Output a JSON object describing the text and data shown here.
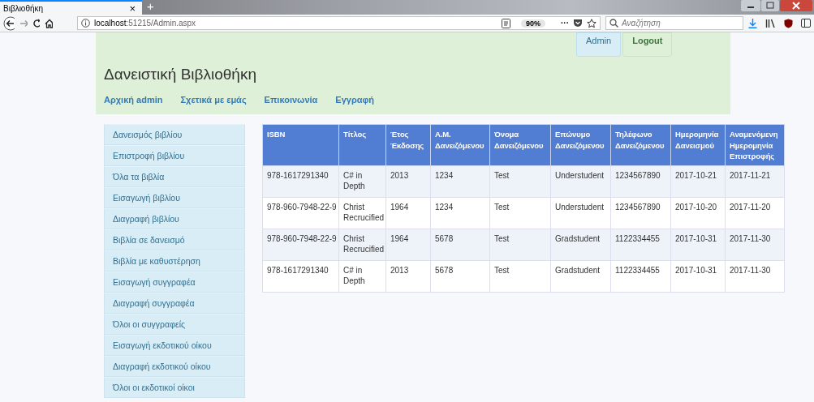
{
  "browser": {
    "tab": {
      "title": "Βιβλιοθήκη",
      "close": "×",
      "selected": true
    },
    "new_tab": "+",
    "url_host": "localhost",
    "url_path": ":51215/Admin.aspx",
    "zoom": "90%",
    "more": "···",
    "search": {
      "placeholder": "Αναζήτηση"
    }
  },
  "header": {
    "title": "Δανειστική Βιβλιοθήκη",
    "nav": [
      "Αρχική admin",
      "Σχετικά με εμάς",
      "Επικοινωνία",
      "Εγγραφή"
    ],
    "buttons": [
      {
        "label": "Admin",
        "kind": "info"
      },
      {
        "label": "Logout",
        "kind": "success"
      }
    ]
  },
  "sidebar": {
    "items": [
      "Δανεισμός βιβλίου",
      "Επιστροφή βιβλίου",
      "Όλα τα βιβλία",
      "Εισαγωγή βιβλίου",
      "Διαγραφή βιβλίου",
      "Βιβλία σε δανεισμό",
      "Βιβλία με καθυστέρηση",
      "Εισαγωγή συγγραφέα",
      "Διαγραφή συγγραφέα",
      "Όλοι οι συγγραφείς",
      "Εισαγωγή εκδοτικού οίκου",
      "Διαγραφή εκδοτικού οίκου",
      "Όλοι οι εκδοτικοί οίκοι"
    ]
  },
  "table": {
    "columns": [
      "ISBN",
      "Τίτλος",
      "Έτος Έκδοσης",
      "Α.Μ. Δανειζόμενου",
      "Όνομα Δανειζόμενου",
      "Επώνυμο Δανειζόμενου",
      "Τηλέφωνο Δανειζόμενου",
      "Ημερομηνία Δανεισμού",
      "Αναμενόμενη Ημερομηνία Επιστροφής"
    ],
    "rows": [
      [
        "978-1617291340",
        "C# in Depth",
        "2013",
        "1234",
        "Test",
        "Understudent",
        "1234567890",
        "2017-10-21",
        "2017-11-21"
      ],
      [
        "978-960-7948-22-9",
        "Christ Recrucified",
        "1964",
        "1234",
        "Test",
        "Understudent",
        "1234567890",
        "2017-10-20",
        "2017-11-20"
      ],
      [
        "978-960-7948-22-9",
        "Christ Recrucified",
        "1964",
        "5678",
        "Test",
        "Gradstudent",
        "1122334455",
        "2017-10-31",
        "2017-11-30"
      ],
      [
        "978-1617291340",
        "C# in Depth",
        "2013",
        "5678",
        "Test",
        "Gradstudent",
        "1122334455",
        "2017-10-31",
        "2017-11-30"
      ]
    ]
  }
}
